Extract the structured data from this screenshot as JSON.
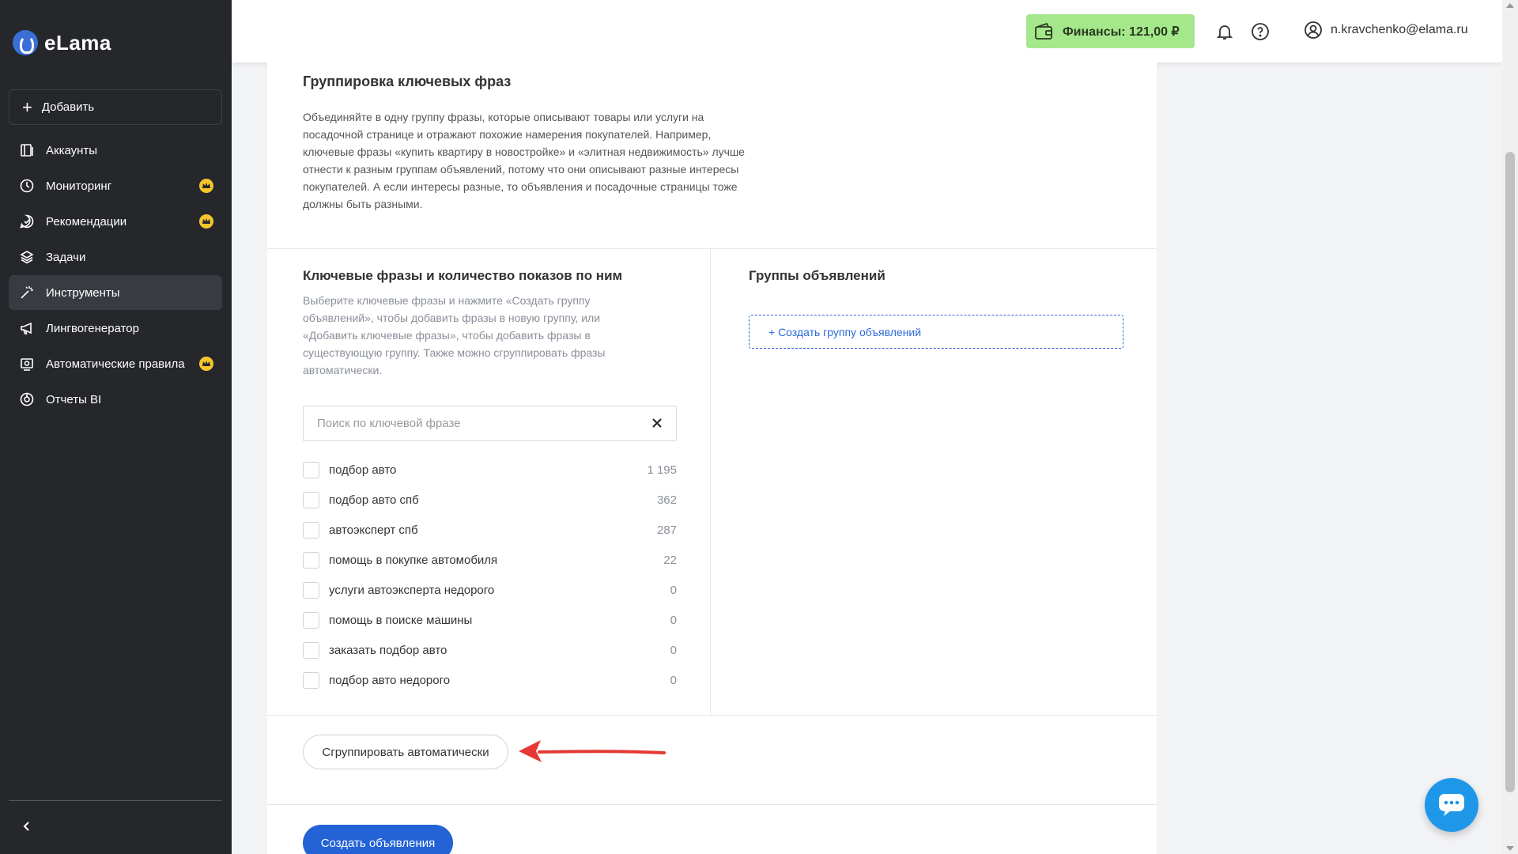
{
  "brand": {
    "name": "eLama"
  },
  "sidebar": {
    "add_label": "Добавить",
    "items": [
      {
        "label": "Аккаунты",
        "icon": "accounts-icon",
        "premium": false,
        "active": false
      },
      {
        "label": "Мониторинг",
        "icon": "monitoring-icon",
        "premium": true,
        "active": false
      },
      {
        "label": "Рекомендации",
        "icon": "recommendations-icon",
        "premium": true,
        "active": false
      },
      {
        "label": "Задачи",
        "icon": "tasks-icon",
        "premium": false,
        "active": false
      },
      {
        "label": "Инструменты",
        "icon": "tools-icon",
        "premium": false,
        "active": true
      },
      {
        "label": "Лингвогенератор",
        "icon": "megaphone-icon",
        "premium": false,
        "active": false
      },
      {
        "label": "Автоматические правила",
        "icon": "rules-icon",
        "premium": true,
        "active": false
      },
      {
        "label": "Отчеты BI",
        "icon": "reports-icon",
        "premium": false,
        "active": false
      }
    ]
  },
  "header": {
    "finance_label": "Финансы: 121,00 ₽",
    "user_email": "n.kravchenko@elama.ru"
  },
  "grouping": {
    "title": "Группировка ключевых фраз",
    "description": "Объединяйте в одну группу фразы, которые описывают товары или услуги на посадочной странице и отражают похожие намерения покупателей. Например, ключевые фразы «купить квартиру в новостройке» и «элитная недвижимость» лучше отнести к разным группам объявлений, потому что они описывают разные интересы покупателей. А если интересы разные, то объявления и посадочные страницы тоже должны быть разными."
  },
  "keywords": {
    "title": "Ключевые фразы и количество показов по ним",
    "description": "Выберите ключевые фразы и нажмите «Создать группу объявлений», чтобы добавить фразы в новую группу, или «Добавить ключевые фразы», чтобы добавить фразы в существующую группу. Также можно сгруппировать фразы автоматически.",
    "search_placeholder": "Поиск по ключевой фразе",
    "rows": [
      {
        "phrase": "подбор авто",
        "count": "1 195"
      },
      {
        "phrase": "подбор авто спб",
        "count": "362"
      },
      {
        "phrase": "автоэксперт спб",
        "count": "287"
      },
      {
        "phrase": "помощь в покупке автомобиля",
        "count": "22"
      },
      {
        "phrase": "услуги автоэксперта недорого",
        "count": "0"
      },
      {
        "phrase": "помощь в поиске машины",
        "count": "0"
      },
      {
        "phrase": "заказать подбор авто",
        "count": "0"
      },
      {
        "phrase": "подбор авто недорого",
        "count": "0"
      }
    ]
  },
  "ad_groups": {
    "title": "Группы объявлений",
    "create_label": "+ Создать группу объявлений"
  },
  "actions": {
    "auto_group_label": "Сгруппировать автоматически",
    "create_ads_label": "Создать объявления"
  },
  "colors": {
    "sidebar_bg": "#25272b",
    "finance_bg": "#a5e88c",
    "primary": "#2363d6",
    "premium": "#f5c52c",
    "arrow": "#e53935",
    "chat": "#1e97e8"
  }
}
